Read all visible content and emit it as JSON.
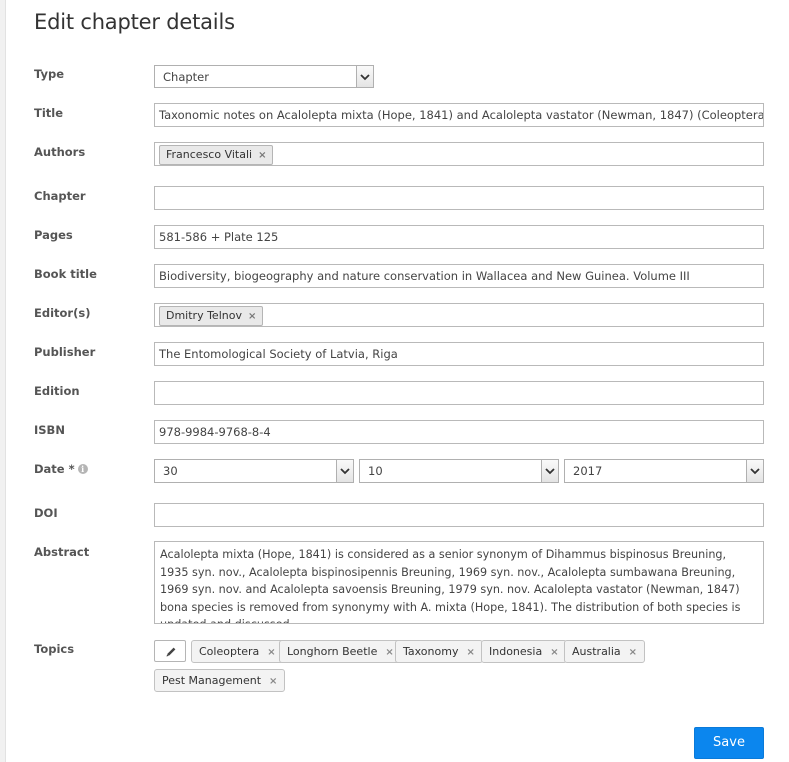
{
  "page": {
    "title": "Edit chapter details"
  },
  "labels": {
    "type": "Type",
    "title": "Title",
    "authors": "Authors",
    "chapter": "Chapter",
    "pages": "Pages",
    "book_title": "Book title",
    "editors": "Editor(s)",
    "publisher": "Publisher",
    "edition": "Edition",
    "isbn": "ISBN",
    "date": "Date *",
    "doi": "DOI",
    "abstract": "Abstract",
    "topics": "Topics"
  },
  "fields": {
    "type": "Chapter",
    "title": "Taxonomic notes on Acalolepta mixta (Hope, 1841) and Acalolepta vastator (Newman, 1847) (Coleoptera: Cerambycidae)",
    "authors": [
      "Francesco Vitali"
    ],
    "chapter": "",
    "pages": "581-586 + Plate 125",
    "book_title": "Biodiversity, biogeography and nature conservation in Wallacea and New Guinea. Volume III",
    "editors": [
      "Dmitry Telnov"
    ],
    "publisher": "The Entomological Society of Latvia, Riga",
    "edition": "",
    "isbn": "978-9984-9768-8-4",
    "date": {
      "day": "30",
      "month": "10",
      "year": "2017"
    },
    "doi": "",
    "abstract": "Acalolepta mixta (Hope, 1841) is considered as a senior synonym of Dihammus bispinosus Breuning, 1935 syn. nov., Acalolepta bispinosipennis Breuning, 1969 syn. nov., Acalolepta sumbawana Breuning, 1969 syn. nov. and Acalolepta savoensis Breuning, 1979 syn. nov. Acalolepta vastator (Newman, 1847) bona species is removed from synonymy with A. mixta (Hope, 1841). The distribution of both species is updated and discussed.",
    "topics": [
      "Coleoptera",
      "Longhorn Beetle",
      "Taxonomy",
      "Indonesia",
      "Australia",
      "Pest Management"
    ]
  },
  "tag_remove_glyph": "×",
  "info_glyph": "i",
  "buttons": {
    "save": "Save"
  },
  "colors": {
    "accent": "#0b86ee",
    "tag_bg": "#e9e9e9"
  }
}
